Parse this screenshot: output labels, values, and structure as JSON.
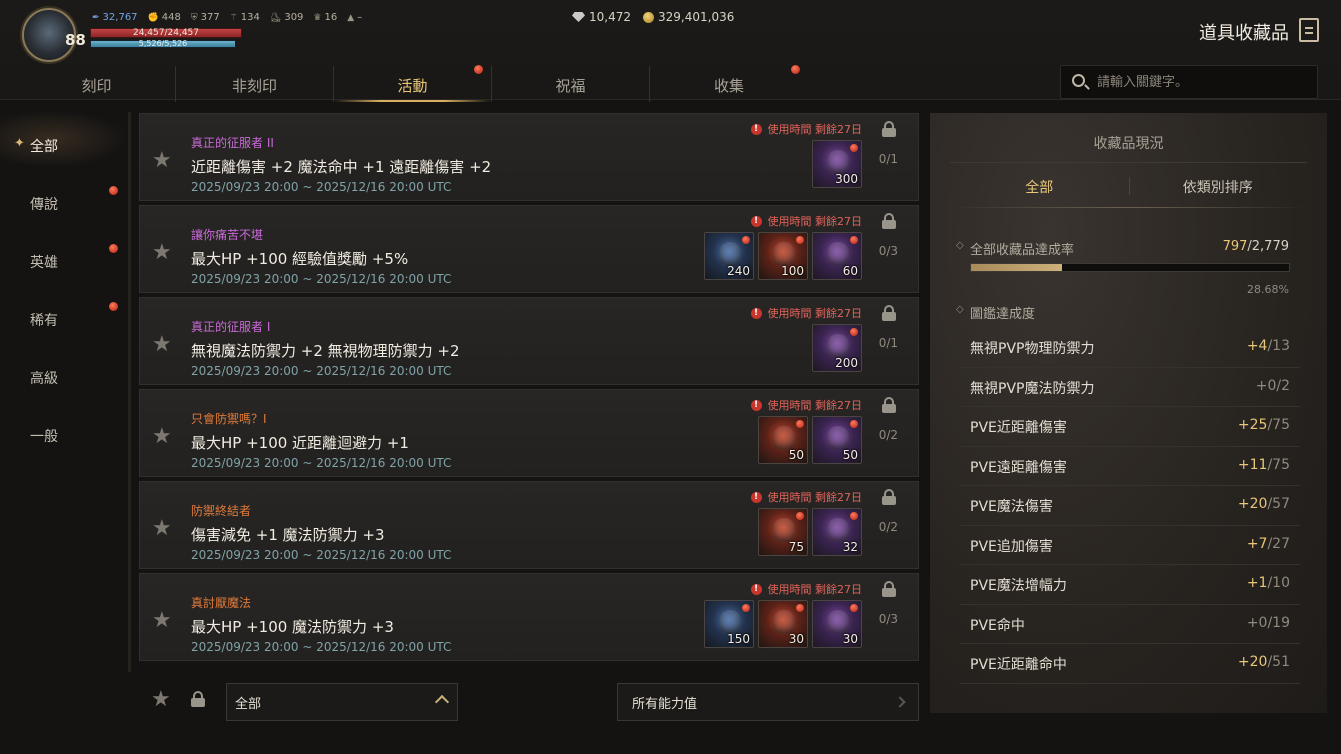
{
  "player": {
    "level": "88",
    "stats": [
      {
        "icon": "feather-icon",
        "value": "32,767",
        "blue": true
      },
      {
        "icon": "fist-icon",
        "value": "448"
      },
      {
        "icon": "shield-icon",
        "value": "377"
      },
      {
        "icon": "wand-icon",
        "value": "134"
      },
      {
        "icon": "boots-icon",
        "value": "309"
      },
      {
        "icon": "trophy-icon",
        "value": "16"
      },
      {
        "icon": "triangle-icon",
        "value": "–"
      }
    ],
    "hp_text": "24,457/24,457",
    "hp_fraction": 1.0,
    "mp_text": "5,526/5,526",
    "mp_fraction": 1.0
  },
  "currency": {
    "diamond": "10,472",
    "gold": "329,401,036"
  },
  "page_title": "道具收藏品",
  "tabs": [
    {
      "label": "刻印",
      "active": false,
      "dot": false
    },
    {
      "label": "非刻印",
      "active": false,
      "dot": false
    },
    {
      "label": "活動",
      "active": true,
      "dot": true
    },
    {
      "label": "祝福",
      "active": false,
      "dot": false
    },
    {
      "label": "收集",
      "active": false,
      "dot": true
    }
  ],
  "search": {
    "placeholder": "請輸入關鍵字。"
  },
  "categories": [
    {
      "label": "全部",
      "active": true,
      "dot": false
    },
    {
      "label": "傳說",
      "active": false,
      "dot": true
    },
    {
      "label": "英雄",
      "active": false,
      "dot": true
    },
    {
      "label": "稀有",
      "active": false,
      "dot": true
    },
    {
      "label": "高級",
      "active": false,
      "dot": false
    },
    {
      "label": "一般",
      "active": false,
      "dot": false
    }
  ],
  "collections": [
    {
      "name": "真正的征服者 II",
      "name_color": "#c86ad8",
      "effect": "近距離傷害 +2 魔法命中 +1 遠距離傷害 +2",
      "date": "2025/09/23 20:00 ~ 2025/12/16 20:00 UTC",
      "timer": "使用時間 剩餘27日",
      "count": "0/1",
      "items": [
        {
          "type": "purple",
          "qty": "300"
        }
      ]
    },
    {
      "name": "讓你痛苦不堪",
      "name_color": "#c86ad8",
      "effect": "最大HP +100 經驗值獎勵 +5%",
      "date": "2025/09/23 20:00 ~ 2025/12/16 20:00 UTC",
      "timer": "使用時間 剩餘27日",
      "count": "0/3",
      "items": [
        {
          "type": "blue",
          "qty": "240"
        },
        {
          "type": "red",
          "qty": "100"
        },
        {
          "type": "purple",
          "qty": "60"
        }
      ]
    },
    {
      "name": "真正的征服者 I",
      "name_color": "#c86ad8",
      "effect": "無視魔法防禦力 +2 無視物理防禦力 +2",
      "date": "2025/09/23 20:00 ~ 2025/12/16 20:00 UTC",
      "timer": "使用時間 剩餘27日",
      "count": "0/1",
      "items": [
        {
          "type": "purple",
          "qty": "200"
        }
      ]
    },
    {
      "name": "只會防禦嗎？I",
      "name_color": "#e07a3a",
      "effect": "最大HP +100 近距離迴避力 +1",
      "date": "2025/09/23 20:00 ~ 2025/12/16 20:00 UTC",
      "timer": "使用時間 剩餘27日",
      "count": "0/2",
      "items": [
        {
          "type": "red",
          "qty": "50"
        },
        {
          "type": "purple",
          "qty": "50"
        }
      ]
    },
    {
      "name": "防禦終結者",
      "name_color": "#e07a3a",
      "effect": "傷害減免 +1 魔法防禦力 +3",
      "date": "2025/09/23 20:00 ~ 2025/12/16 20:00 UTC",
      "timer": "使用時間 剩餘27日",
      "count": "0/2",
      "items": [
        {
          "type": "red",
          "qty": "75"
        },
        {
          "type": "purple",
          "qty": "32"
        }
      ]
    },
    {
      "name": "真討厭魔法",
      "name_color": "#e07a3a",
      "effect": "最大HP +100 魔法防禦力 +3",
      "date": "2025/09/23 20:00 ~ 2025/12/16 20:00 UTC",
      "timer": "使用時間 剩餘27日",
      "count": "0/3",
      "items": [
        {
          "type": "blue",
          "qty": "150"
        },
        {
          "type": "red",
          "qty": "30"
        },
        {
          "type": "purple",
          "qty": "30"
        }
      ]
    }
  ],
  "bottom": {
    "filter_value": "全部",
    "stats_label": "所有能力值"
  },
  "status_panel": {
    "title": "收藏品現況",
    "tabs": [
      {
        "label": "全部",
        "active": true
      },
      {
        "label": "依類別排序",
        "active": false
      }
    ],
    "rate_label": "全部收藏品達成率",
    "rate_done": "797",
    "rate_total": "/2,779",
    "rate_fraction": 0.2868,
    "rate_pct": "28.68%",
    "codex_label": "圖鑑達成度",
    "bonuses": [
      {
        "label": "無視PVP物理防禦力",
        "plus": "+4",
        "max": "/13"
      },
      {
        "label": "無視PVP魔法防禦力",
        "plus": "+0",
        "max": "/2"
      },
      {
        "label": "PVE近距離傷害",
        "plus": "+25",
        "max": "/75"
      },
      {
        "label": "PVE遠距離傷害",
        "plus": "+11",
        "max": "/75"
      },
      {
        "label": "PVE魔法傷害",
        "plus": "+20",
        "max": "/57"
      },
      {
        "label": "PVE追加傷害",
        "plus": "+7",
        "max": "/27"
      },
      {
        "label": "PVE魔法增幅力",
        "plus": "+1",
        "max": "/10"
      },
      {
        "label": "PVE命中",
        "plus": "+0",
        "max": "/19"
      },
      {
        "label": "PVE近距離命中",
        "plus": "+20",
        "max": "/51"
      }
    ]
  },
  "colors": {
    "accent_gold": "#e8c67a",
    "timer_red": "#e0645a",
    "date_teal": "#7fa3a7",
    "legendary_purple": "#c86ad8",
    "heroic_orange": "#e07a3a"
  }
}
